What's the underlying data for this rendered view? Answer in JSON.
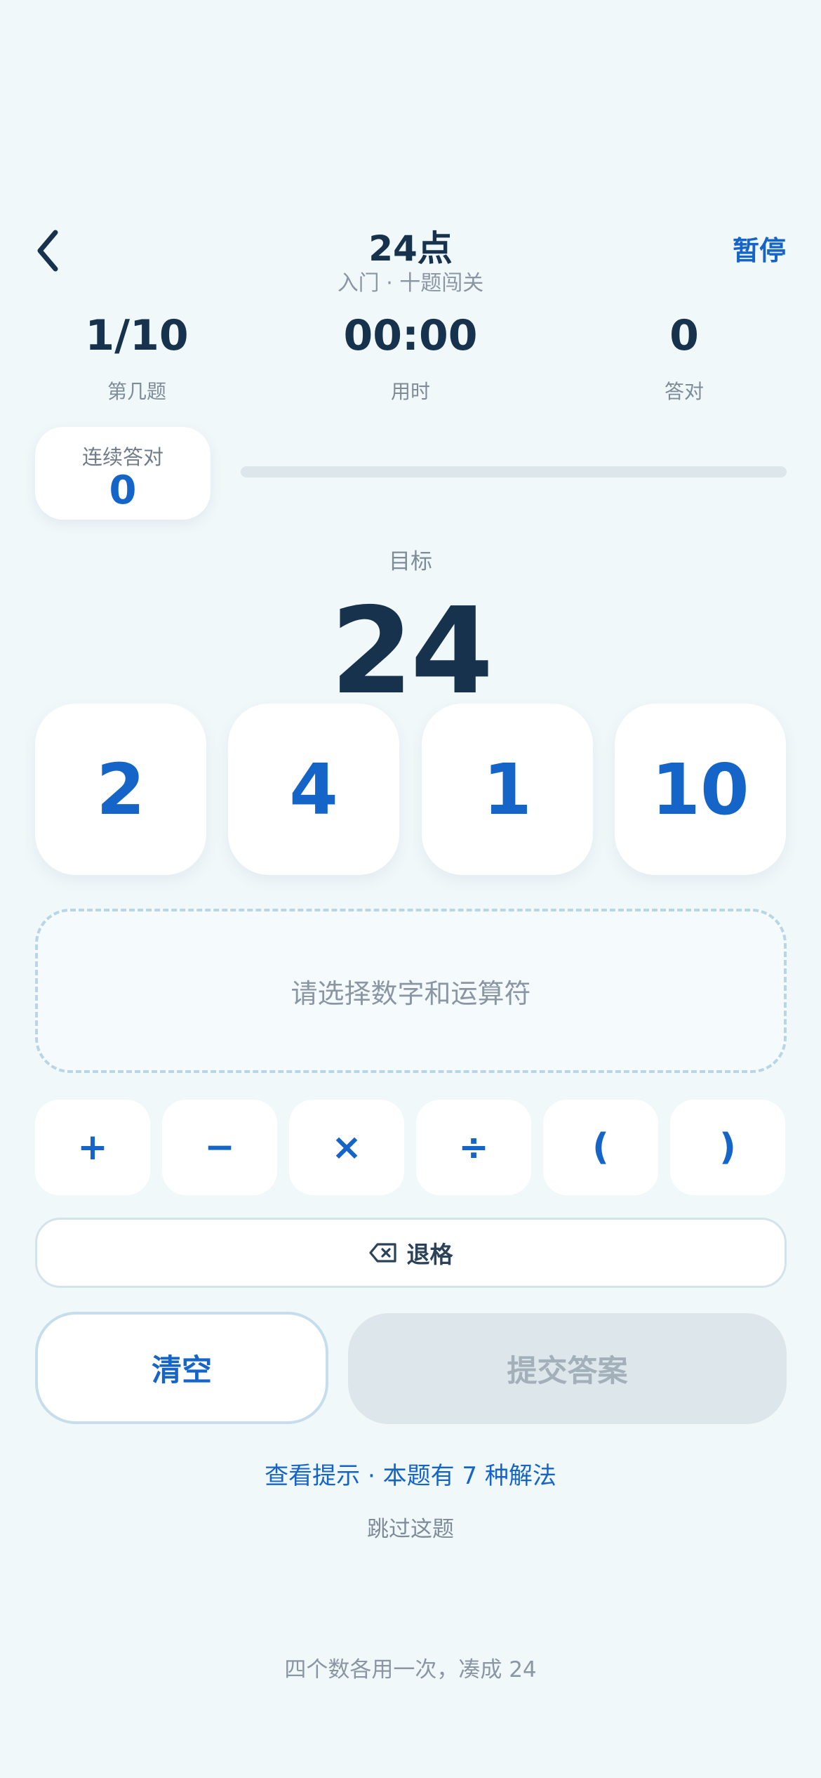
{
  "header": {
    "title": "24点",
    "subtitle": "入门 · 十题闯关",
    "pause_label": "暂停",
    "back_icon": "chevron-left-icon"
  },
  "stats": [
    {
      "value": "1/10",
      "label": "第几题"
    },
    {
      "value": "00:00",
      "label": "用时"
    },
    {
      "value": "0",
      "label": "答对"
    }
  ],
  "streak": {
    "label": "连续答对",
    "value": "0"
  },
  "progress": {
    "fraction": 0
  },
  "target": {
    "label": "目标",
    "value": "24"
  },
  "numbers": [
    "2",
    "4",
    "1",
    "10"
  ],
  "expression": {
    "placeholder": "请选择数字和运算符"
  },
  "operators": [
    "+",
    "−",
    "×",
    "÷",
    "(",
    ")"
  ],
  "backspace": {
    "label": "退格",
    "icon": "backspace-icon"
  },
  "actions": {
    "clear_label": "清空",
    "submit_label": "提交答案"
  },
  "hint": {
    "text": "查看提示 · 本题有 7 种解法"
  },
  "skip": {
    "text": "跳过这题"
  },
  "rules": {
    "text": "四个数各用一次，凑成 24"
  },
  "colors": {
    "accent": "#1565c8",
    "text": "#17324d",
    "background": "#f1f8fa",
    "disabled": "#dde6ea"
  }
}
